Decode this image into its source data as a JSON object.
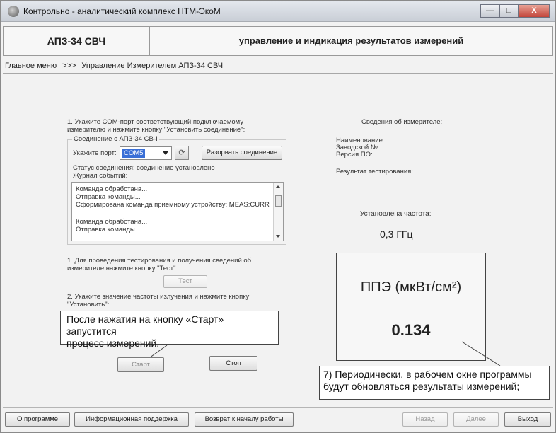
{
  "window": {
    "title": "Контрольно - аналитический комплекс НТМ-ЭкоМ",
    "controls": {
      "minimize": "—",
      "maximize": "□",
      "close": "X"
    }
  },
  "header": {
    "device": "АПЗ-34 СВЧ",
    "section": "управление и индикация результатов измерений"
  },
  "breadcrumb": {
    "home": "Главное меню",
    "separator": ">>>",
    "current": "Управление Измерителем АПЗ-34 СВЧ"
  },
  "step1": {
    "instruction_line1": "1. Укажите СОМ-порт соответствующий подключаемому",
    "instruction_line2": "измерителю и нажмите кнопку \"Установить соединение\":",
    "group_title": "Соединение с АПЗ-34 СВЧ",
    "port_label": "Укажите порт:",
    "port_value": "COM5",
    "disconnect_button": "Разорвать соединение",
    "status_label": "Статус соединения:",
    "status_value": "соединение установлено",
    "log_label": "Журнал событий:",
    "log_lines": [
      "Команда обработана...",
      "Отправка команды...",
      "Сформирована команда приемному устройству: MEAS:CURR",
      "",
      "Команда обработана...",
      "Отправка команды..."
    ]
  },
  "test": {
    "instruction_line1": "1. Для проведения тестирования и получения сведений об",
    "instruction_line2": "измерителе нажмите кнопку \"Тест\":",
    "button": "Тест"
  },
  "step2": {
    "instruction_line1": "2. Укажите значение частоты излучения и нажмите кнопку",
    "instruction_line2": "\"Установить\":"
  },
  "callout_start": {
    "line1": "После нажатия на кнопку «Старт» запустится",
    "line2": "процесс измерений."
  },
  "measure_buttons": {
    "start": "Старт",
    "stop": "Стоп"
  },
  "device_info": {
    "title": "Сведения об измерителе:",
    "name_label": "Наименование:",
    "serial_label": "Заводской №:",
    "version_label": "Версия ПО:",
    "test_result_label": "Результат тестирования:"
  },
  "frequency": {
    "label": "Установлена частота:",
    "value": "0,3 ГГц"
  },
  "ppe": {
    "title": "ППЭ (мкВт/см²)",
    "value": "0.134"
  },
  "callout_periodic": {
    "line1": "7) Периодически, в рабочем окне программы",
    "line2": "будут обновляться результаты измерений;"
  },
  "footer": {
    "about": "О программе",
    "support": "Информационная поддержка",
    "restart": "Возврат к началу работы",
    "back": "Назад",
    "next": "Далее",
    "exit": "Выход"
  }
}
